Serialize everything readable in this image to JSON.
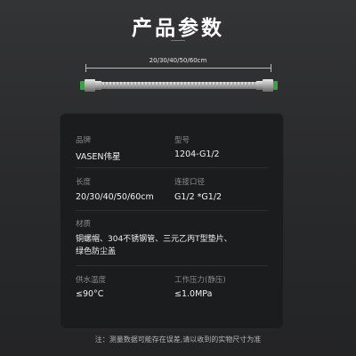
{
  "title": "产品参数",
  "dimension_label": "20/30/40/50/60cm",
  "specs": {
    "brand_label": "品牌",
    "brand_value": "VASEN伟星",
    "model_label": "型号",
    "model_value": "1204-G1/2",
    "length_label": "长度",
    "length_value": "20/30/40/50/60cm",
    "port_label": "连接口径",
    "port_value": "G1/2 *G1/2",
    "material_label": "材质",
    "material_value_line1": "铜螺帽、304不锈钢管、三元乙丙T型垫片、",
    "material_value_line2": "绿色防尘盖",
    "temp_label": "供水温度",
    "temp_value": "≤90°C",
    "pressure_label": "工作压力(静压)",
    "pressure_value": "≤1.0MPa"
  },
  "footnote": "注：测量数据可能存在误差,请以收到的实物尺寸为准",
  "colors": {
    "background": "#2b2c2e",
    "card": "#1b1c1e",
    "hose_steel": "#cfcfcf",
    "cap_green": "#4caf50"
  }
}
